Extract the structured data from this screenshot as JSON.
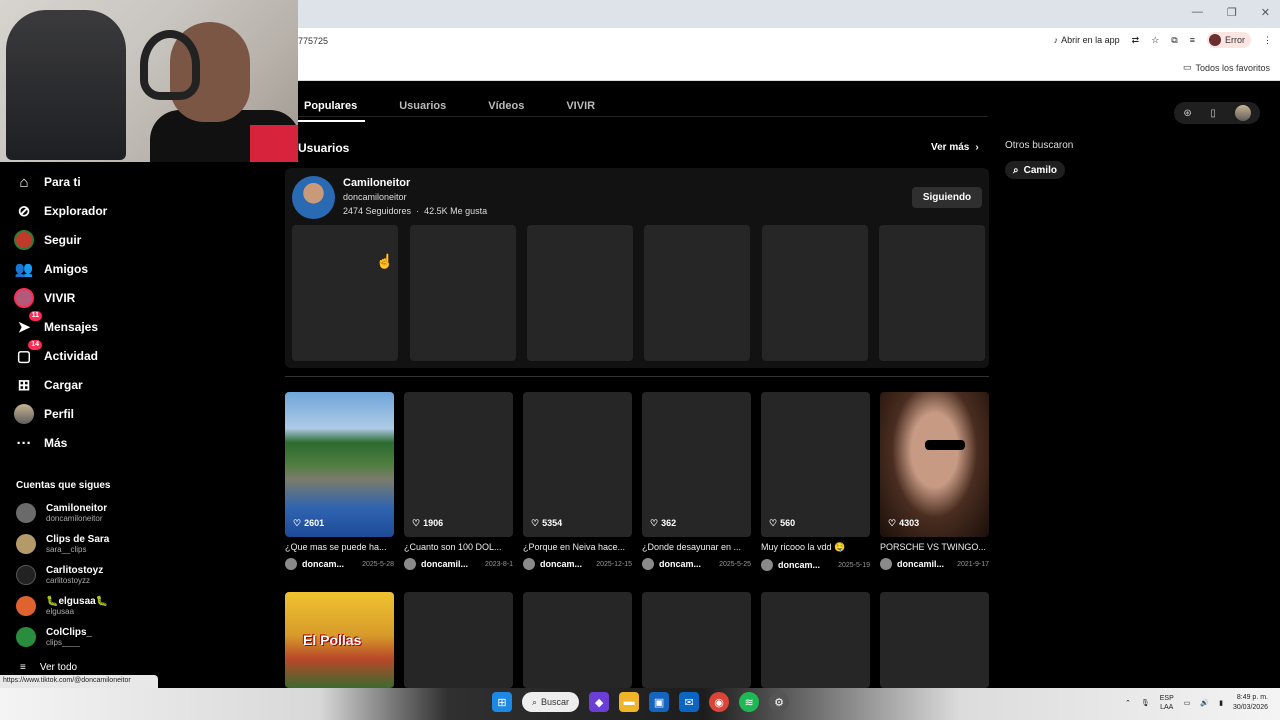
{
  "browser": {
    "url_fragment": "775725",
    "open_in_app": "Abrir en la app",
    "error_label": "Error",
    "favorites": "Todos los favoritos",
    "status_url": "https://www.tiktok.com/@doncamiloneitor"
  },
  "sidebar": {
    "items": [
      {
        "label": "Para ti",
        "icon": "home-icon"
      },
      {
        "label": "Explorador",
        "icon": "compass-icon"
      },
      {
        "label": "Seguir",
        "icon": "avatar-icon"
      },
      {
        "label": "Amigos",
        "icon": "friends-icon"
      },
      {
        "label": "VIVIR",
        "icon": "live-icon"
      },
      {
        "label": "Mensajes",
        "icon": "messages-icon",
        "badge": "11"
      },
      {
        "label": "Actividad",
        "icon": "activity-icon",
        "badge": "14"
      },
      {
        "label": "Cargar",
        "icon": "upload-icon"
      },
      {
        "label": "Perfil",
        "icon": "profile-icon"
      },
      {
        "label": "Más",
        "icon": "more-icon"
      }
    ],
    "following_title": "Cuentas que sigues",
    "following": [
      {
        "name": "Camiloneitor",
        "handle": "doncamiloneitor",
        "color": "#6a6a6a"
      },
      {
        "name": "Clips de Sara",
        "handle": "sara__clips",
        "color": "#b49a68"
      },
      {
        "name": "Carlitostoyz",
        "handle": "carlitostoyzz",
        "color": "#222222"
      },
      {
        "name": "🐛elgusaa🐛",
        "handle": "elgusaa",
        "color": "#e0632f"
      },
      {
        "name": "ColClips_",
        "handle": "clips____",
        "color": "#2a8d3d"
      }
    ],
    "see_all": "Ver todo"
  },
  "tabs": [
    "Populares",
    "Usuarios",
    "Vídeos",
    "VIVIR"
  ],
  "users_section": {
    "title": "Usuarios",
    "see_more": "Ver más",
    "user": {
      "name": "Camiloneitor",
      "handle": "doncamiloneitor",
      "followers": "2474 Seguidores",
      "separator": "·",
      "likes": "42.5K Me gusta",
      "follow_state": "Siguiendo"
    }
  },
  "videos_row1": [
    {
      "likes": "2601",
      "caption": "¿Que mas se puede ha...",
      "author": "doncam...",
      "date": "2025-5-28",
      "thumb": "river"
    },
    {
      "likes": "1906",
      "caption": "¿Cuanto son 100 DOL...",
      "author": "doncamil...",
      "date": "2023-8-1",
      "thumb": "blank"
    },
    {
      "likes": "5354",
      "caption": "¿Porque en Neiva hace...",
      "author": "doncam...",
      "date": "2025-12-15",
      "thumb": "blank"
    },
    {
      "likes": "362",
      "caption": "¿Donde desayunar en ...",
      "author": "doncam...",
      "date": "2025-5-25",
      "thumb": "blank"
    },
    {
      "likes": "560",
      "caption": "Muy ricooo la vdd 🤤",
      "author": "doncam...",
      "date": "2025-5-19",
      "thumb": "blank"
    },
    {
      "likes": "4303",
      "caption": "PORSCHE VS TWINGO...",
      "author": "doncamil...",
      "date": "2021-9-17",
      "thumb": "movie"
    }
  ],
  "videos_row2_text": "El Pollas",
  "right_panel": {
    "title": "Otros buscaron",
    "chip": "Camilo"
  },
  "taskbar": {
    "search": "Buscar",
    "lang": "ESP",
    "lang2": "LAA",
    "time": "8:49 p. m.",
    "date": "30/03/2026"
  }
}
